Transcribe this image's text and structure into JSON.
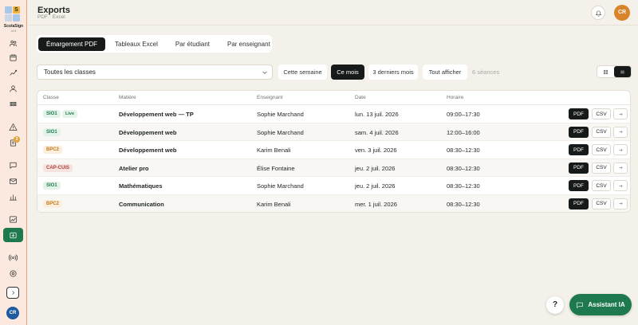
{
  "app": {
    "brand": "ScolaSign",
    "version": "v2.6",
    "logo_letter": "S"
  },
  "sidebar": {
    "badge_count": "3",
    "icons": [
      "users-icon",
      "calendar-icon",
      "analytics-icon",
      "user-icon",
      "grid-icon",
      "warning-icon",
      "document-icon",
      "chat-icon",
      "mail-icon",
      "org-chart-icon",
      "trend-chart-icon",
      "export-icon",
      "broadcast-icon",
      "settings-icon"
    ],
    "user_initials": "CR"
  },
  "header": {
    "title": "Exports",
    "subtitle": "PDF · Excel",
    "user_initials": "CR"
  },
  "tabs": [
    {
      "label": "Émargement PDF",
      "active": true
    },
    {
      "label": "Tableaux Excel",
      "active": false
    },
    {
      "label": "Par étudiant",
      "active": false
    },
    {
      "label": "Par enseignant",
      "active": false
    }
  ],
  "filters": {
    "class_select": "Toutes les classes",
    "periods": [
      {
        "label": "Cette semaine",
        "active": false
      },
      {
        "label": "Ce mois",
        "active": true
      },
      {
        "label": "3 derniers mois",
        "active": false
      },
      {
        "label": "Tout afficher",
        "active": false
      }
    ],
    "count": "6 séances"
  },
  "table": {
    "columns": [
      "Classe",
      "Matière",
      "Enseignant",
      "Date",
      "Horaire"
    ],
    "rows": [
      {
        "class": "SIO1",
        "live": "Live",
        "subject": "Développement web — TP",
        "teacher": "Sophie Marchand",
        "date": "lun. 13 juil. 2026",
        "time": "09:00–17:30"
      },
      {
        "class": "SIO1",
        "live": "",
        "subject": "Développement web",
        "teacher": "Sophie Marchand",
        "date": "sam. 4 juil. 2026",
        "time": "12:00–16:00"
      },
      {
        "class": "BPC2",
        "live": "",
        "subject": "Développement web",
        "teacher": "Karim Benali",
        "date": "ven. 3 juil. 2026",
        "time": "08:30–12:30"
      },
      {
        "class": "CAP-CUIS",
        "live": "",
        "subject": "Atelier pro",
        "teacher": "Élise Fontaine",
        "date": "jeu. 2 juil. 2026",
        "time": "08:30–12:30"
      },
      {
        "class": "SIO1",
        "live": "",
        "subject": "Mathématiques",
        "teacher": "Sophie Marchand",
        "date": "jeu. 2 juil. 2026",
        "time": "08:30–12:30"
      },
      {
        "class": "BPC2",
        "live": "",
        "subject": "Communication",
        "teacher": "Karim Benali",
        "date": "mer. 1 juil. 2026",
        "time": "08:30–12:30"
      }
    ],
    "actions": {
      "pdf": "PDF",
      "csv": "CSV"
    }
  },
  "class_colors": {
    "SIO1": {
      "bg": "#e4f3ea",
      "fg": "#1e7a4e"
    },
    "BPC2": {
      "bg": "#fbeedd",
      "fg": "#c47a1e"
    },
    "CAP-CUIS": {
      "bg": "#f6e3e0",
      "fg": "#a8453b"
    }
  },
  "floating": {
    "help": "?",
    "assistant": "Assistant IA"
  },
  "colors": {
    "accent": "#1e7a4e",
    "dark": "#161a18",
    "sidebar_bg": "#fbe8de",
    "page_bg": "#f4f1ea"
  }
}
